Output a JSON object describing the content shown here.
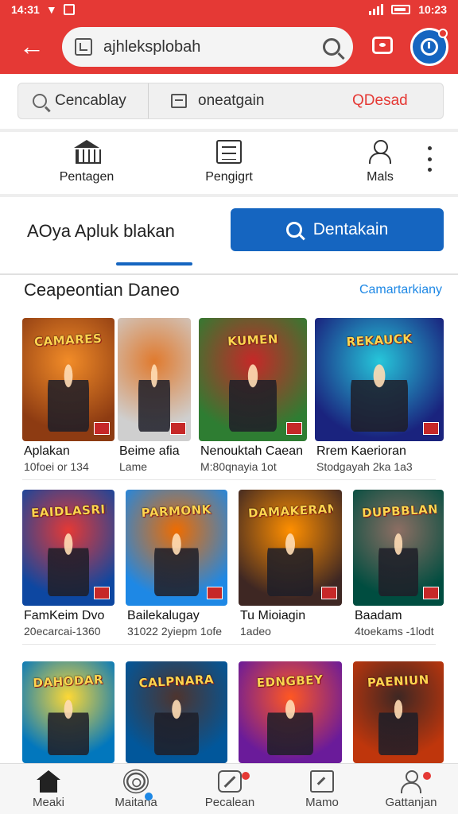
{
  "status": {
    "time": "14:31",
    "right_text": "10:23"
  },
  "topbar": {
    "url_text": "ajhleksplobah",
    "accent_color": "#e53935"
  },
  "filters": {
    "first": "Cencablay",
    "second": "oneatgain",
    "third": "QDesad"
  },
  "categories": [
    {
      "label": "Pentagen",
      "icon": "bank-icon"
    },
    {
      "label": "Pengigrt",
      "icon": "list-icon"
    },
    {
      "label": "Mals",
      "icon": "user-search-icon"
    }
  ],
  "search": {
    "app_title": "AOya Apluk blakan",
    "button_label": "Dentakain",
    "button_color": "#1565c0"
  },
  "section": {
    "title": "Ceapeontian Daneo",
    "see_all": "Camartarkiany"
  },
  "games": [
    {
      "name": "Aplakan",
      "meta": "10foei or 134",
      "logo": "CAMARES",
      "c1": "#8d3b12",
      "c2": "#f28c28"
    },
    {
      "name": "Beime afia",
      "meta": "Lame",
      "logo": "",
      "c1": "#cfcfcf",
      "c2": "#e07a2e"
    },
    {
      "name": "Nenouktah Caean",
      "meta": "M:80qnayia 1ot",
      "logo": "KUMEN",
      "c1": "#2e7d32",
      "c2": "#c62828"
    },
    {
      "name": "Rrem Kaerioran",
      "meta": "Stodgayah 2ka 1a3",
      "logo": "REKAUCK",
      "c1": "#1a237e",
      "c2": "#26c6da"
    },
    {
      "name": "FamKeim Dvo",
      "meta": "20ecarcai-1360",
      "logo": "EAIDLASRIE",
      "c1": "#0d47a1",
      "c2": "#e53935"
    },
    {
      "name": "Bailekalugay",
      "meta": "31022 2yiepm 1ofe",
      "logo": "PARMONK",
      "c1": "#1e88e5",
      "c2": "#ef6c00"
    },
    {
      "name": "Tu Mioiagin",
      "meta": "1adeo",
      "logo": "DAMAKERAN",
      "c1": "#3e2723",
      "c2": "#ff8f00"
    },
    {
      "name": "Baadam",
      "meta": "4toekams -1lodt",
      "logo": "DUPBBLAN",
      "c1": "#004d40",
      "c2": "#8d6e63"
    },
    {
      "name": "",
      "meta": "",
      "logo": "DAHODAR",
      "c1": "#0277bd",
      "c2": "#fdd835"
    },
    {
      "name": "",
      "meta": "",
      "logo": "CALPNARA",
      "c1": "#01579b",
      "c2": "#4e342e"
    },
    {
      "name": "",
      "meta": "",
      "logo": "EDNGBEY",
      "c1": "#6a1b9a",
      "c2": "#ff5722"
    },
    {
      "name": "",
      "meta": "",
      "logo": "PAENIUN",
      "c1": "#bf360c",
      "c2": "#3e2723"
    }
  ],
  "bottom_nav": [
    {
      "label": "Meaki",
      "icon": "home-icon"
    },
    {
      "label": "Maitana",
      "icon": "gear-icon"
    },
    {
      "label": "Pecalean",
      "icon": "edit-icon"
    },
    {
      "label": "Mamo",
      "icon": "app-icon"
    },
    {
      "label": "Gattanjan",
      "icon": "person-icon"
    }
  ]
}
